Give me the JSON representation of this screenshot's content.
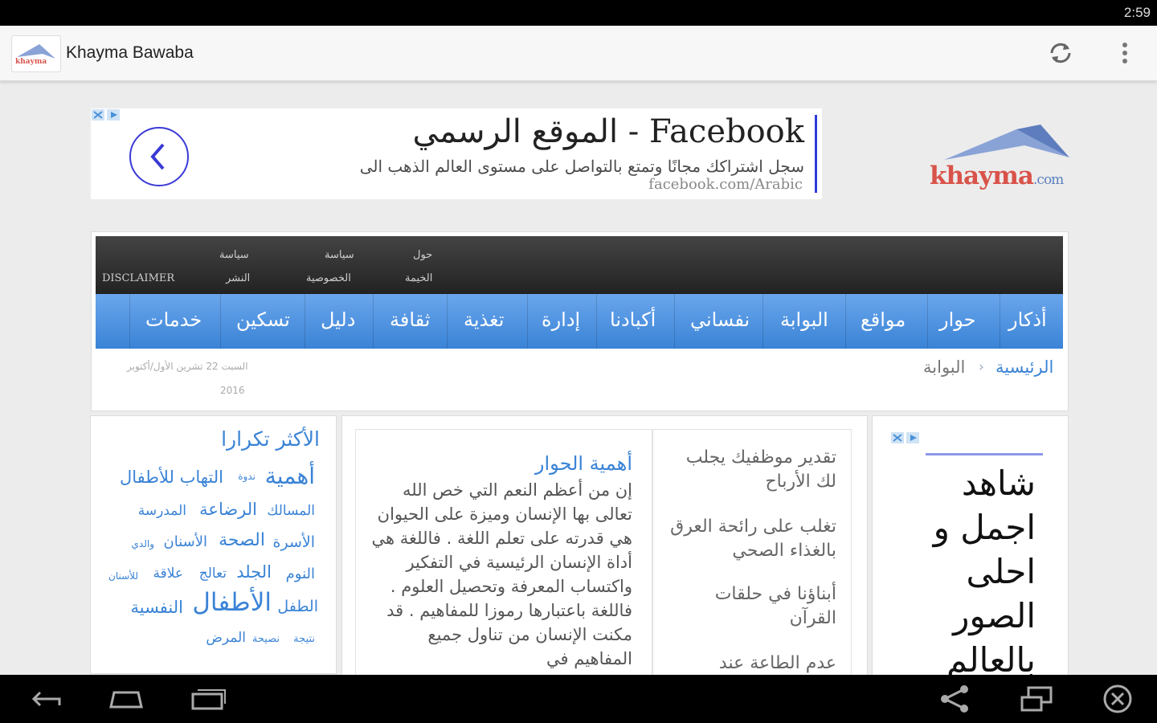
{
  "status_bar": {
    "time": "2:59"
  },
  "app_bar": {
    "title": "Khayma Bawaba",
    "refresh_icon": "refresh-icon",
    "overflow_icon": "overflow-menu-icon"
  },
  "ad_top": {
    "headline": "Facebook - الموقع الرسمي",
    "description": "سجل اشتراكك مجانًا وتمتع بالتواصل على مستوى العالم الذهب الى",
    "url": "facebook.com/Arabic"
  },
  "logo": {
    "word": "khayma",
    "suffix": ".com"
  },
  "site": {
    "top_links": [
      {
        "line1": "حول",
        "line2": "الخيمة"
      },
      {
        "line1": "سياسة",
        "line2": "الخصوصية"
      },
      {
        "line1": "سياسة",
        "line2": "النشر"
      },
      {
        "line1": "",
        "line2": "DISCLAIMER"
      }
    ],
    "menu": [
      "أذكار",
      "حوار",
      "مواقع",
      "البوابة",
      "نفساني",
      "أكبادنا",
      "إدارة",
      "تغذية",
      "ثقافة",
      "دليل",
      "تسكين",
      "خدمات"
    ],
    "breadcrumb": {
      "home": "الرئيسية",
      "separator": "›",
      "current": "البوابة"
    },
    "date_line1": "السبت 22 تشرين الأول/أكتوبر",
    "date_line2": "2016"
  },
  "most_repeated": {
    "title": "الأكثر تكرارا",
    "tags": [
      "أهمية",
      "ندوة",
      "التهاب للأطفال",
      "المسالك",
      "الرضاعة",
      "المدرسة",
      "الأسرة",
      "الصحة",
      "الأسنان",
      "والدي",
      "النوم",
      "الجلد",
      "تعالج",
      "علاقة",
      "للأسنان",
      "الطفل",
      "الأطفال",
      "النفسية",
      "نتيجة",
      "نصيحة",
      "المرض"
    ]
  },
  "article": {
    "title": "أهمية الحوار",
    "body": "إن من أعظم النعم التي خص الله تعالى بها الإنسان وميزة على الحيوان هي قدرته على تعلم اللغة . فاللغة هي أداة الإنسان الرئيسية في التفكير واكتساب المعرفة وتحصيل العلوم . فاللغة باعتبارها رموزا للمفاهيم . قد مكنت الإنسان من تناول جميع المفاهيم في"
  },
  "side_list": {
    "items": [
      "تقدير موظفيك يجلب لك الأرباح",
      "تغلب على رائحة العرق بالغذاء الصحي",
      "أبناؤنا في حلقات القرآن",
      "عدم الطاعة عند"
    ]
  },
  "ad_right": {
    "text": "شاهد اجمل و احلى الصور بالعالم"
  },
  "nav_bar": {
    "icons": [
      "back-icon",
      "home-icon",
      "recent-apps-icon",
      "share-icon",
      "screen-mirror-icon",
      "close-circle-icon"
    ]
  }
}
